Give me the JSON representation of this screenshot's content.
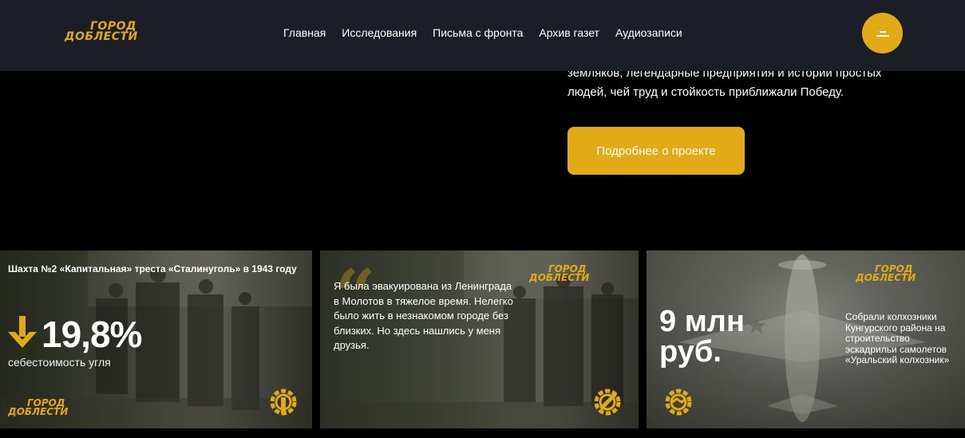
{
  "header": {
    "logo": {
      "line1": "ГОРОД",
      "line2": "ДОБЛЕСТИ"
    },
    "nav": [
      "Главная",
      "Исследования",
      "Письма с фронта",
      "Архив газет",
      "Аудиозаписи"
    ],
    "menu_icon": "hamburger-icon"
  },
  "intro": {
    "text": "земляков, легендарные предприятия и истории простых людей, чей труд и стойкость приближали Победу.",
    "button_label": "Подробнее о проекте"
  },
  "cards": [
    {
      "caption": "Шахта №2 «Капитальная» треста «Сталинуголь» в 1943 году",
      "value": "19,8%",
      "sub": "себестоимость угля",
      "logo": {
        "line1": "ГОРОД",
        "line2": "ДОБЛЕСТИ"
      },
      "icon": "gear-wrench-icon",
      "arrow_icon": "arrow-down-icon"
    },
    {
      "quote": "Я была эвакуирована из Ленинграда в Молотов в тяжелое время. Нелегко было жить в незнакомом городе без близких. Но здесь нашлись у меня друзья.",
      "logo": {
        "line1": "ГОРОД",
        "line2": "ДОБЛЕСТИ"
      },
      "icon": "gear-pencil-icon"
    },
    {
      "value_line1": "9 млн",
      "value_line2": "руб.",
      "note": "Собрали колхозники Кунгурского района на строительство эскадрильи самолетов «Уральский колхозник»",
      "logo": {
        "line1": "ГОРОД",
        "line2": "ДОБЛЕСТИ"
      },
      "icon": "gear-handshake-icon"
    }
  ],
  "colors": {
    "accent": "#e2aa17",
    "header_bg": "#1b1e27",
    "page_bg": "#000000"
  }
}
